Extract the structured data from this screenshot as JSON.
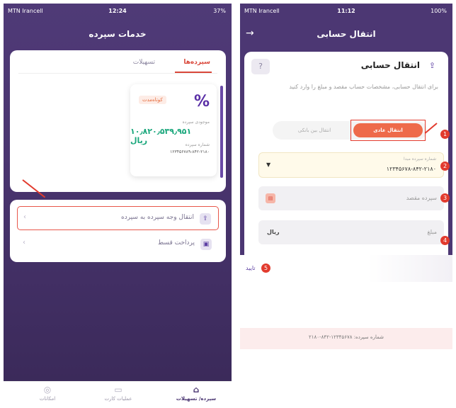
{
  "left": {
    "status": {
      "carrier": "MTN Irancell",
      "time": "12:24",
      "battery": "37%"
    },
    "title": "خدمات سپرده",
    "tabs": [
      {
        "label": "سپرده‌ها",
        "active": true
      },
      {
        "label": "تسهیلات",
        "active": false
      }
    ],
    "account": {
      "badge": "کوتاه‌مدت",
      "balance_label": "موجودی سپرده",
      "balance": "۱۰٫۸۲۰٫۵۳۹٫۹۵۱ ریال",
      "number_label": "شماره سپرده",
      "number": "۱۲۳۴۵۶۷۸۹-۸۴۲-۲۱۸۰"
    },
    "menu": [
      {
        "label": "انتقال وجه سپرده به سپرده",
        "icon": "⇪",
        "icon_name": "transfer-icon",
        "highlighted": true
      },
      {
        "label": "پرداخت قسط",
        "icon": "▣",
        "icon_name": "installment-icon",
        "highlighted": false
      }
    ],
    "nav": [
      {
        "label": "سپرده/ تسهیلات",
        "icon": "⌂",
        "icon_name": "deposit-icon",
        "active": true
      },
      {
        "label": "عملیات کارت",
        "icon": "▭",
        "icon_name": "card-icon",
        "active": false
      },
      {
        "label": "امکانات",
        "icon": "◎",
        "icon_name": "settings-icon",
        "active": false
      }
    ]
  },
  "right": {
    "status": {
      "carrier": "MTN Irancell",
      "time": "11:12",
      "battery": "100%"
    },
    "title": "انتقال حسابی",
    "card_title": "انتقال حسابی",
    "description": "برای انتقال حسابی، مشخصات حساب مقصد و مبلغ را وارد کنید",
    "segments": {
      "active": "انتقال عادی",
      "inactive": "انتقال بین بانکی"
    },
    "fields": {
      "source_label": "شماره سپرده مبدا",
      "source_value": "۱۲۳۴۵۶۷۸-۸۴۲-۲۱۸۰",
      "dest_placeholder": "سپرده مقصد",
      "amount_placeholder": "مبلغ",
      "amount_unit": "ریال"
    },
    "next_label": "تایید",
    "footer": "شماره سپرده: ۱۲۳۴۵۶۷۸-۸۴۲-۲۱۸۰",
    "step_badges": [
      "1",
      "2",
      "3",
      "4",
      "5"
    ]
  },
  "colors": {
    "brand_purple": "#4c3773",
    "accent_orange": "#ee6a4a",
    "highlight_red": "#e23b2e",
    "balance_green": "#1aa77c"
  }
}
